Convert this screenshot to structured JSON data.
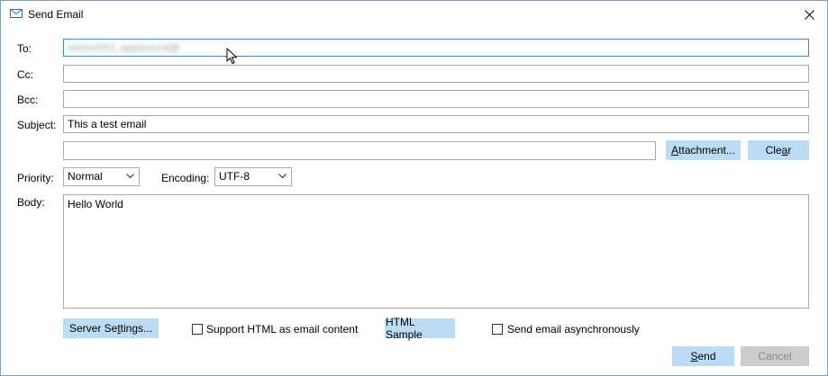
{
  "window": {
    "title": "Send Email",
    "icon": "mail-icon",
    "close_icon": "close-icon"
  },
  "labels": {
    "to": "To:",
    "cc": "Cc:",
    "bcc": "Bcc:",
    "subject": "Subject:",
    "priority": "Priority:",
    "encoding": "Encoding:",
    "body": "Body:"
  },
  "fields": {
    "to_value": "tester001.appsoord@",
    "cc_value": "",
    "bcc_value": "",
    "subject_value": "This a test email",
    "attachment_value": "",
    "body_value": "Hello World"
  },
  "selects": {
    "priority_value": "Normal",
    "encoding_value": "UTF-8"
  },
  "buttons": {
    "attachment_pre": "",
    "attachment_accel": "A",
    "attachment_post": "ttachment...",
    "clear_pre": "Cle",
    "clear_accel": "a",
    "clear_post": "r",
    "server_settings_pre": "Server Se",
    "server_settings_accel": "t",
    "server_settings_post": "tings...",
    "html_sample": "HTML Sample",
    "send_pre": "",
    "send_accel": "S",
    "send_post": "end",
    "cancel": "Cancel"
  },
  "checkboxes": {
    "support_html_label": "Support HTML as email content",
    "support_html_checked": false,
    "async_label": "Send email asynchronously",
    "async_checked": false
  },
  "colors": {
    "button_bg": "#bcdcf4",
    "focus_border": "#3a86d6",
    "disabled_bg": "#cccccc"
  }
}
